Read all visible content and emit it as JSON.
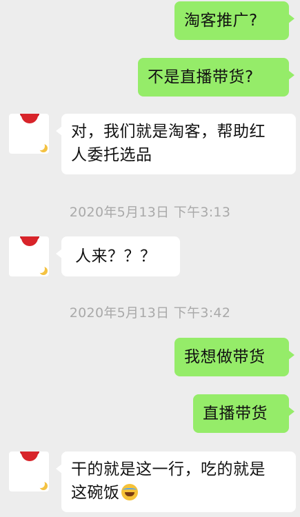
{
  "messages": {
    "m1": "淘客推广?",
    "m2": "不是直播带货?",
    "m3_line1": "对，我们就是淘客，帮助红",
    "m3_line2": "人委托选品",
    "ts1": "2020年5月13日 下午3:13",
    "m4": "人来？？？",
    "ts2": "2020年5月13日 下午3:42",
    "m5": "我想做带货",
    "m6": "直播带货",
    "m7_line1": "干的就是这一行，吃的就是",
    "m7_line2": "这碗饭"
  },
  "icons": {
    "avatar": "avatar-red-hat",
    "emoji": "laughing-tears-emoji"
  },
  "colors": {
    "background": "#ededed",
    "sent_bubble": "#95ec69",
    "received_bubble": "#ffffff",
    "timestamp_text": "#a9a9a9"
  }
}
